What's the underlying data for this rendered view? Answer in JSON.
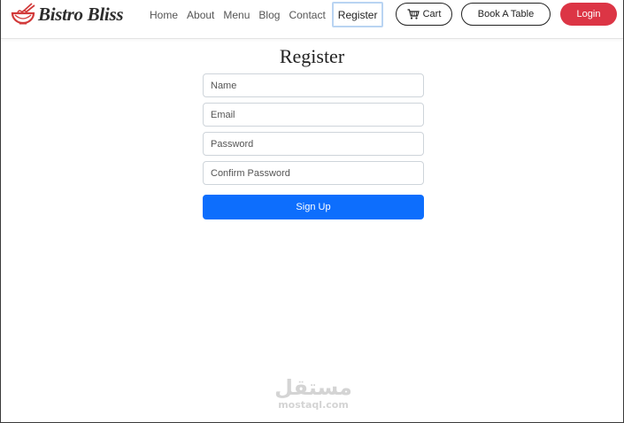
{
  "brand": {
    "name": "Bistro Bliss",
    "logo_icon": "noodle-bowl-icon"
  },
  "nav": {
    "links": [
      {
        "label": "Home"
      },
      {
        "label": "About"
      },
      {
        "label": "Menu"
      },
      {
        "label": "Blog"
      },
      {
        "label": "Contact"
      },
      {
        "label": "Register",
        "active": true
      }
    ],
    "cart_label": "Cart",
    "cart_icon": "shopping-cart-icon",
    "book_label": "Book A Table",
    "login_label": "Login"
  },
  "form": {
    "title": "Register",
    "fields": [
      {
        "placeholder": "Name",
        "value": ""
      },
      {
        "placeholder": "Email",
        "value": ""
      },
      {
        "placeholder": "Password",
        "value": ""
      },
      {
        "placeholder": "Confirm Password",
        "value": ""
      }
    ],
    "submit_label": "Sign Up"
  },
  "watermark": {
    "arabic": "مستقل",
    "latin": "mostaql.com"
  },
  "colors": {
    "login": "#dc3545",
    "primary": "#0d6efd",
    "active_outline": "#b9d4f2",
    "logo": "#d23a3a"
  }
}
